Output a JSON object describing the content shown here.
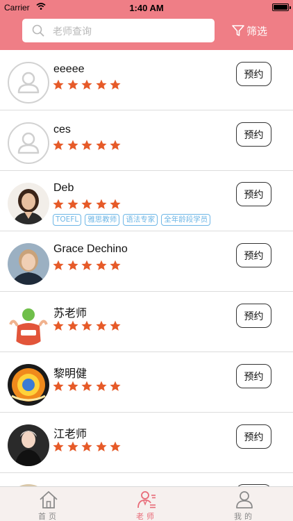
{
  "status_bar": {
    "carrier": "Carrier",
    "time": "1:40 AM"
  },
  "header": {
    "search_placeholder": "老师查询",
    "filter_label": "筛选"
  },
  "colors": {
    "header_bg": "#ef7e86",
    "star": "#e65a28",
    "tag": "#6db6e6",
    "tab_active": "#e86b78"
  },
  "teachers": [
    {
      "name": "eeeee",
      "rating": 5,
      "book_label": "预约",
      "tags": []
    },
    {
      "name": "ces",
      "rating": 5,
      "book_label": "预约",
      "tags": []
    },
    {
      "name": "Deb",
      "rating": 5,
      "book_label": "预约",
      "tags": [
        "TOEFL",
        "雅思教师",
        "语法专家",
        "全年龄段学员"
      ]
    },
    {
      "name": "Grace Dechino",
      "rating": 5,
      "book_label": "预约",
      "tags": []
    },
    {
      "name": "苏老师",
      "rating": 5,
      "book_label": "预约",
      "tags": []
    },
    {
      "name": "黎明健",
      "rating": 5,
      "book_label": "预约",
      "tags": []
    },
    {
      "name": "江老师",
      "rating": 5,
      "book_label": "预约",
      "tags": []
    }
  ],
  "tabbar": {
    "items": [
      {
        "label": "首页",
        "icon": "home-icon",
        "active": false
      },
      {
        "label": "老师",
        "icon": "teacher-icon",
        "active": true
      },
      {
        "label": "我的",
        "icon": "user-icon",
        "active": false
      }
    ]
  }
}
